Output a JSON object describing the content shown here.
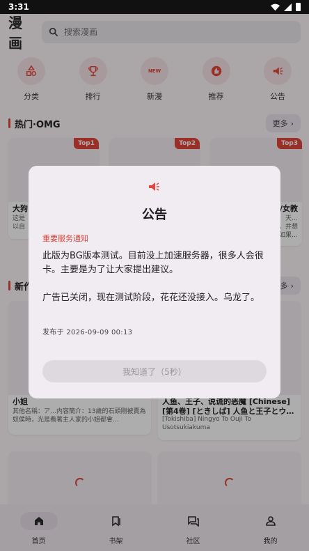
{
  "status": {
    "time": "3:31"
  },
  "header": {
    "title": "漫画",
    "search_placeholder": "搜索漫画"
  },
  "categories": [
    {
      "label": "分类",
      "icon": "shapes-icon"
    },
    {
      "label": "排行",
      "icon": "trophy-icon"
    },
    {
      "label": "新漫",
      "icon": "new-badge-icon",
      "icon_text": "NEW"
    },
    {
      "label": "推荐",
      "icon": "thumbs-up-icon"
    },
    {
      "label": "公告",
      "icon": "megaphone-icon"
    }
  ],
  "hot_section": {
    "title": "热门·OMG",
    "more_label": "更多"
  },
  "hot_cards": [
    {
      "badge": "Top1",
      "title": "大狗",
      "sub": "这是\n以自"
    },
    {
      "badge": "Top2",
      "title": "",
      "sub": ""
    },
    {
      "badge": "Top3",
      "title": "/女教",
      "sub": "天…\n，并想\n如果…"
    }
  ],
  "new_section": {
    "title": "新作",
    "more_label": "多"
  },
  "new_cards": [
    {
      "title": "小姐",
      "sub": "其他名稱：ア…内容簡介：13歲的石頭剛被賣為奴侯時，光是看著主人家的小姐都會…"
    },
    {
      "title": "人鱼、王子、说谎的恶魔 [Chinese] [第4卷] [ときしば] 人鱼と王子とウ…",
      "sub": "[Tokishiba] Ningyo To Ouji To Usotsukiakuma"
    }
  ],
  "bottom_nav": [
    {
      "label": "首页",
      "icon": "home-icon",
      "active": true
    },
    {
      "label": "书架",
      "icon": "bookmark-icon",
      "active": false
    },
    {
      "label": "社区",
      "icon": "forum-icon",
      "active": false
    },
    {
      "label": "我的",
      "icon": "person-icon",
      "active": false
    }
  ],
  "dialog": {
    "icon": "megaphone-icon",
    "title": "公告",
    "tag": "重要服务通知",
    "body": "此版为BG版本测试。目前没上加速服务器，很多人会很卡。主要是为了让大家提出建议。\n\n广告已关闭，现在测试阶段，花花还没接入。乌龙了。",
    "date": "发布于 2026-09-09 00:13",
    "button_label": "我知道了（5秒）"
  },
  "colors": {
    "accent": "#e4463a",
    "background": "#fdf7fa",
    "dialog_bg": "#f1ebf2"
  }
}
